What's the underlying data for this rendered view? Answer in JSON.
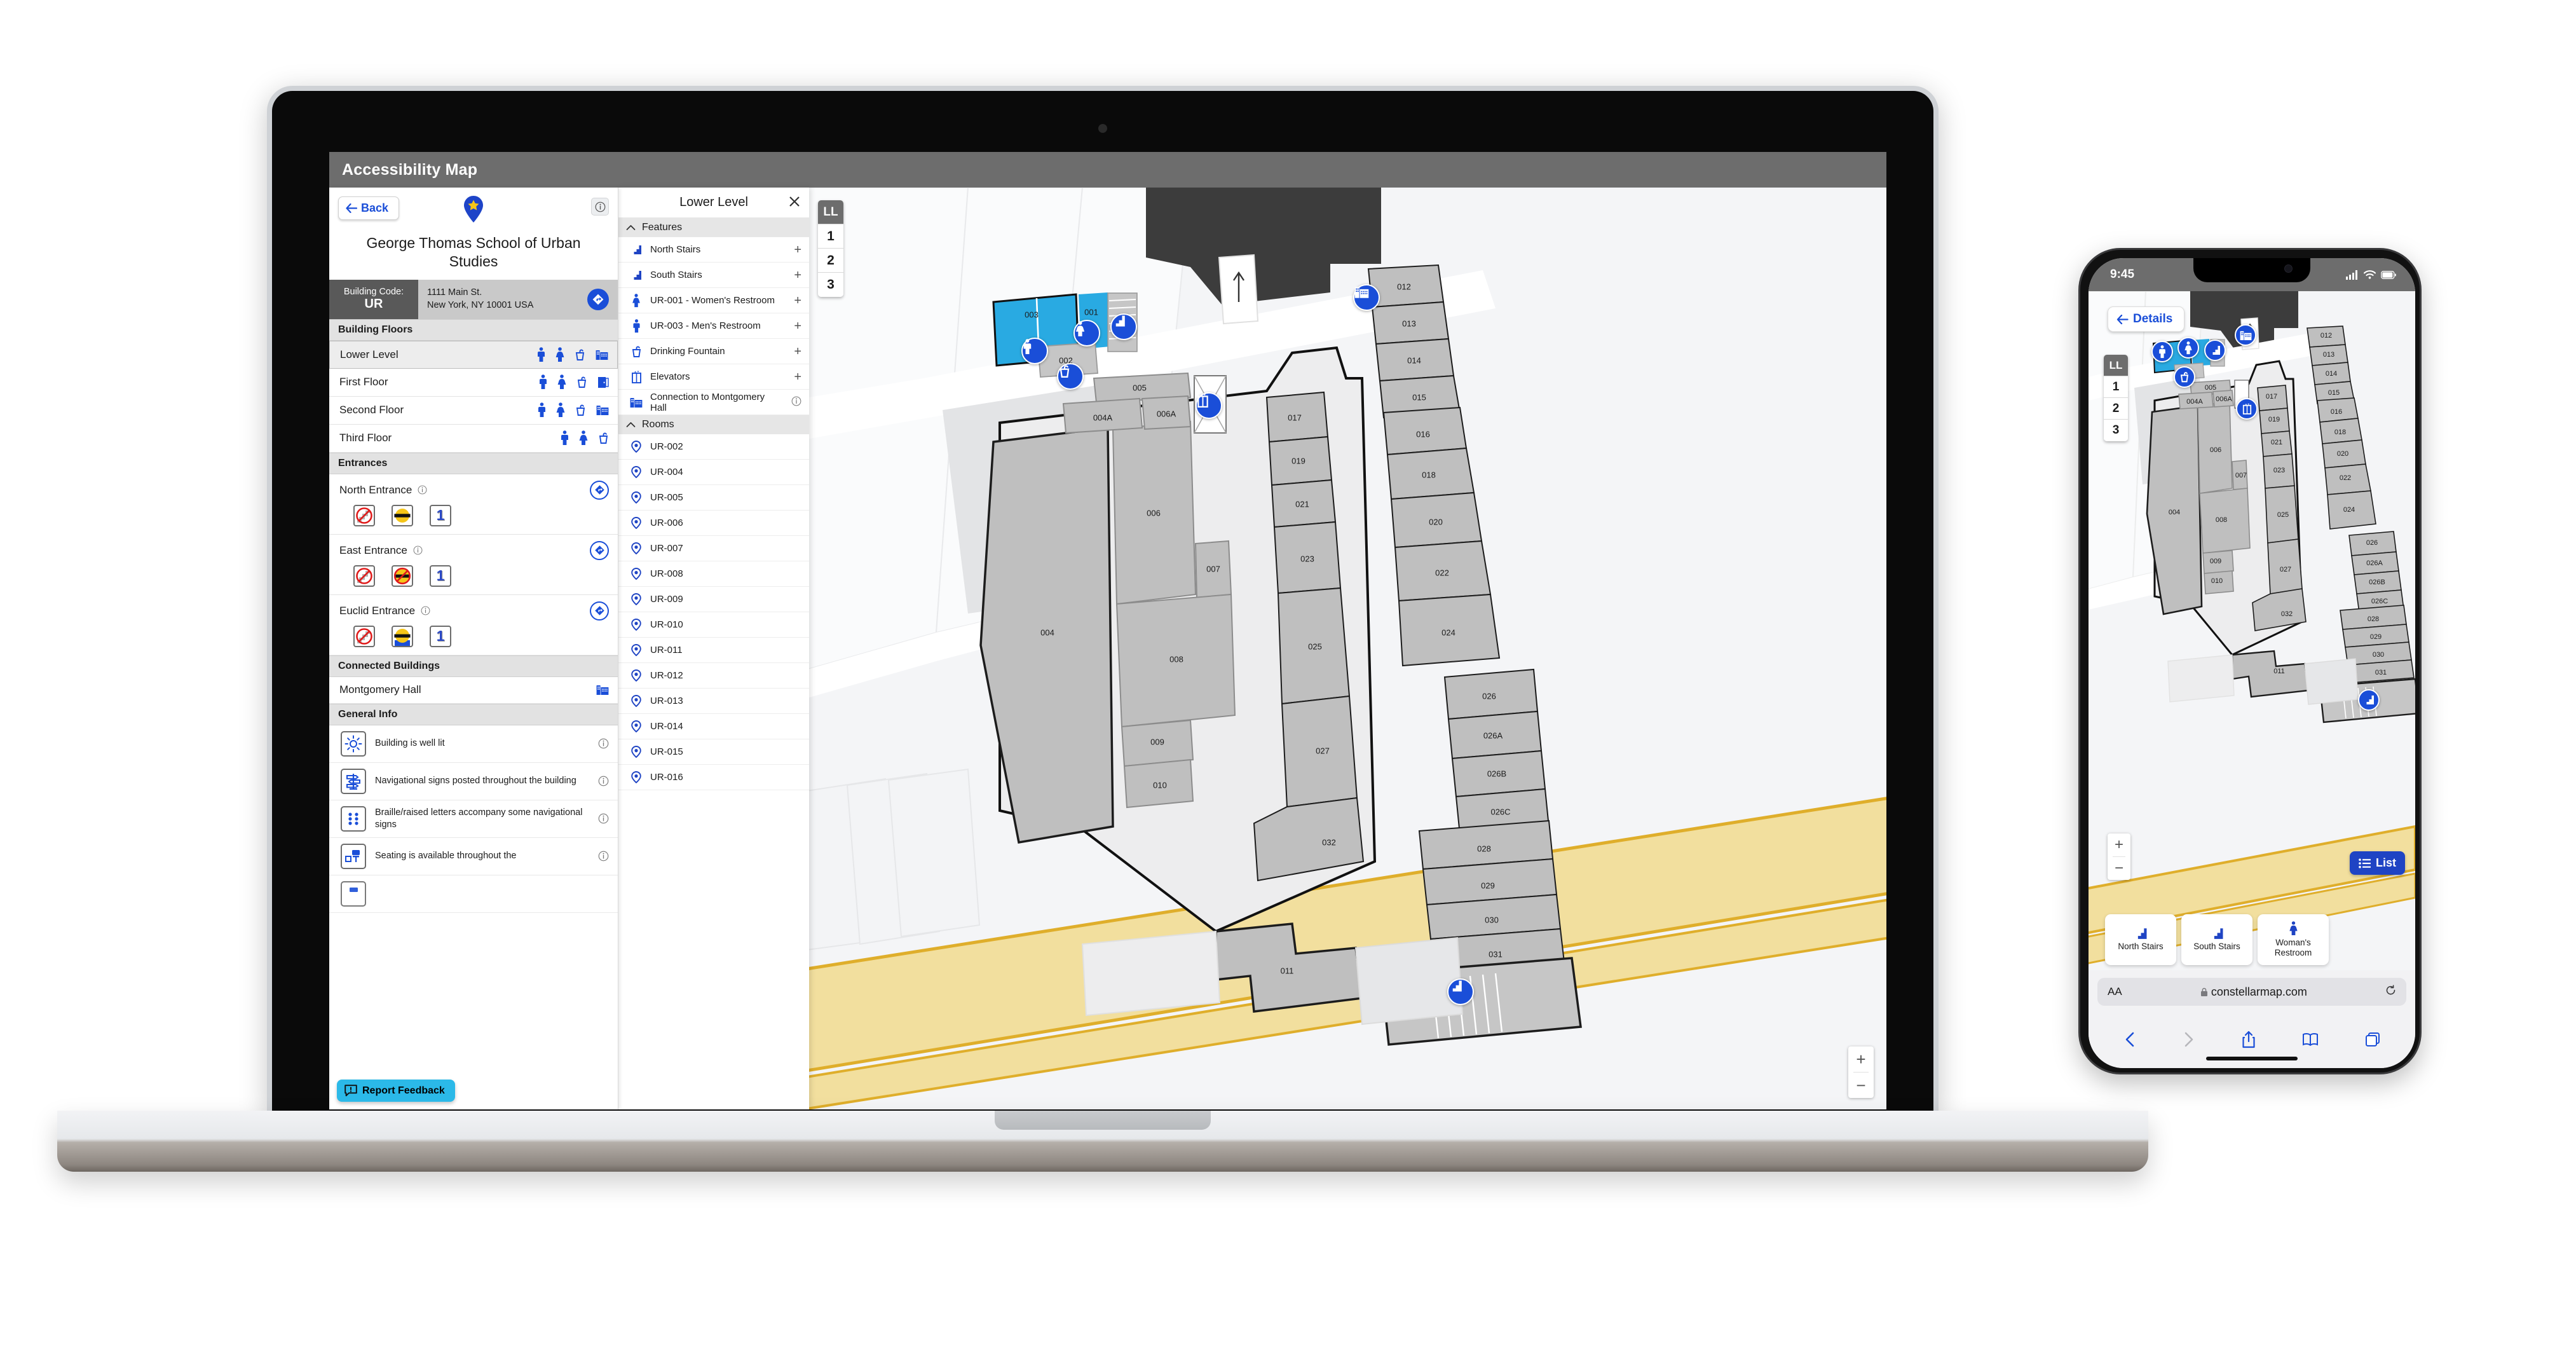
{
  "app": {
    "title": "Accessibility Map"
  },
  "sidebar": {
    "back_label": "Back",
    "info_icon": "info-circle-icon",
    "pin_icon": "map-pin-star-icon",
    "building_name": "George Thomas School of Urban Studies",
    "building_code_label": "Building Code:",
    "building_code_value": "UR",
    "address_line1": "1111 Main St.",
    "address_line2": "New York, NY 10001 USA",
    "directions_icon": "directions-diamond-icon",
    "sections": {
      "floors": "Building Floors",
      "entrances": "Entrances",
      "connected": "Connected Buildings",
      "general": "General Info"
    },
    "floors": [
      {
        "label": "Lower Level",
        "active": true,
        "icons": [
          "mens-restroom-icon",
          "womens-restroom-icon",
          "drinking-fountain-icon",
          "connected-building-icon"
        ]
      },
      {
        "label": "First Floor",
        "active": false,
        "icons": [
          "mens-restroom-icon",
          "womens-restroom-icon",
          "drinking-fountain-icon",
          "entrance-door-icon"
        ]
      },
      {
        "label": "Second Floor",
        "active": false,
        "icons": [
          "mens-restroom-icon",
          "womens-restroom-icon",
          "drinking-fountain-icon",
          "connected-building-icon"
        ]
      },
      {
        "label": "Third Floor",
        "active": false,
        "icons": [
          "mens-restroom-icon",
          "womens-restroom-icon",
          "drinking-fountain-icon"
        ]
      }
    ],
    "entrances": [
      {
        "name": "North Entrance",
        "badges": [
          "no-stairs-icon",
          "automatic-door-icon",
          "level-1-icon"
        ]
      },
      {
        "name": "East Entrance",
        "badges": [
          "no-stairs-icon",
          "no-automatic-door-icon",
          "level-1-icon"
        ]
      },
      {
        "name": "Euclid Entrance",
        "badges": [
          "no-stairs-icon",
          "automatic-door-partial-icon",
          "level-1-icon"
        ]
      }
    ],
    "entrance_level_label": "1",
    "connected_buildings": [
      {
        "name": "Montgomery Hall",
        "icon": "connected-building-icon"
      }
    ],
    "general_info": [
      {
        "icon": "sun-icon",
        "text": "Building is well lit"
      },
      {
        "icon": "signpost-icon",
        "text": "Navigational signs posted throughout the building"
      },
      {
        "icon": "braille-icon",
        "text": "Braille/raised letters accompany some navigational signs"
      },
      {
        "icon": "seating-icon",
        "text": "Seating is available throughout the"
      }
    ],
    "feedback_label": "Report Feedback",
    "feedback_icon": "feedback-chat-icon"
  },
  "level_panel": {
    "title": "Lower Level",
    "close_icon": "close-icon",
    "features_label": "Features",
    "rooms_label": "Rooms",
    "collapse_icon": "chevron-up-icon",
    "features": [
      {
        "label": "North Stairs",
        "icon": "stairs-icon",
        "action": "+"
      },
      {
        "label": "South Stairs",
        "icon": "stairs-icon",
        "action": "+"
      },
      {
        "label": "UR-001 - Women's Restroom",
        "icon": "womens-restroom-icon",
        "action": "+"
      },
      {
        "label": "UR-003 - Men's Restroom",
        "icon": "mens-restroom-icon",
        "action": "+"
      },
      {
        "label": "Drinking Fountain",
        "icon": "drinking-fountain-icon",
        "action": "+"
      },
      {
        "label": "Elevators",
        "icon": "elevator-icon",
        "action": "+"
      },
      {
        "label": "Connection to Montgomery Hall",
        "icon": "connected-building-icon",
        "action": "i"
      }
    ],
    "rooms": [
      {
        "label": "UR-002",
        "icon": "map-pin-icon"
      },
      {
        "label": "UR-004",
        "icon": "map-pin-icon"
      },
      {
        "label": "UR-005",
        "icon": "map-pin-icon"
      },
      {
        "label": "UR-006",
        "icon": "map-pin-icon"
      },
      {
        "label": "UR-007",
        "icon": "map-pin-icon"
      },
      {
        "label": "UR-008",
        "icon": "map-pin-icon"
      },
      {
        "label": "UR-009",
        "icon": "map-pin-icon"
      },
      {
        "label": "UR-010",
        "icon": "map-pin-icon"
      },
      {
        "label": "UR-011",
        "icon": "map-pin-icon"
      },
      {
        "label": "UR-012",
        "icon": "map-pin-icon"
      },
      {
        "label": "UR-013",
        "icon": "map-pin-icon"
      },
      {
        "label": "UR-014",
        "icon": "map-pin-icon"
      },
      {
        "label": "UR-015",
        "icon": "map-pin-icon"
      },
      {
        "label": "UR-016",
        "icon": "map-pin-icon"
      }
    ]
  },
  "map": {
    "floor_selector": [
      {
        "label": "LL",
        "selected": true
      },
      {
        "label": "1",
        "selected": false
      },
      {
        "label": "2",
        "selected": false
      },
      {
        "label": "3",
        "selected": false
      }
    ],
    "zoom_in": "+",
    "zoom_out": "−",
    "colors": {
      "accent_blue": "#1a4ed8",
      "highlight_cyan": "#29aae2",
      "road_yellow": "#f2df9e",
      "road_yellow_border": "#dfae2b",
      "room_fill": "#bfbfbf",
      "corridor_fill": "#ededed",
      "dark_building": "#3c3c3c"
    },
    "room_labels": [
      "003",
      "001",
      "002",
      "005",
      "004A",
      "006A",
      "004",
      "006",
      "007",
      "008",
      "009",
      "010",
      "011",
      "012",
      "013",
      "014",
      "015",
      "016",
      "017",
      "018",
      "019",
      "020",
      "021",
      "022",
      "023",
      "024",
      "025",
      "026",
      "026A",
      "026B",
      "026C",
      "027",
      "028",
      "029",
      "030",
      "031",
      "032"
    ],
    "markers": [
      {
        "icon": "connected-building-icon",
        "label": "Connection to Montgomery Hall"
      },
      {
        "icon": "stairs-icon",
        "label": "North Stairs"
      },
      {
        "icon": "womens-restroom-icon",
        "label": "UR-001 - Women's Restroom"
      },
      {
        "icon": "mens-restroom-icon",
        "label": "UR-003 - Men's Restroom"
      },
      {
        "icon": "drinking-fountain-icon",
        "label": "Drinking Fountain"
      },
      {
        "icon": "elevator-icon",
        "label": "Elevators"
      },
      {
        "icon": "stairs-icon",
        "label": "South Stairs"
      }
    ]
  },
  "phone": {
    "status_time": "9:45",
    "signal_icon": "cellular-signal-icon",
    "wifi_icon": "wifi-icon",
    "battery_icon": "battery-icon",
    "details_label": "Details",
    "back_arrow_icon": "arrow-left-icon",
    "floor_selector": [
      {
        "label": "LL",
        "selected": true
      },
      {
        "label": "1",
        "selected": false
      },
      {
        "label": "2",
        "selected": false
      },
      {
        "label": "3",
        "selected": false
      }
    ],
    "zoom_in": "+",
    "zoom_out": "−",
    "list_label": "List",
    "list_icon": "list-icon",
    "cards": [
      {
        "label": "North Stairs",
        "icon": "stairs-icon"
      },
      {
        "label": "South Stairs",
        "icon": "stairs-icon"
      },
      {
        "label": "Woman's Restroom",
        "icon": "womens-restroom-icon"
      }
    ],
    "browser": {
      "text_size_label": "AA",
      "lock_icon": "lock-icon",
      "url": "constellarmap.com",
      "reload_icon": "reload-icon",
      "back_icon": "chevron-left-icon",
      "forward_icon": "chevron-right-icon",
      "share_icon": "share-icon",
      "bookmarks_icon": "book-icon",
      "tabs_icon": "tabs-icon"
    }
  }
}
